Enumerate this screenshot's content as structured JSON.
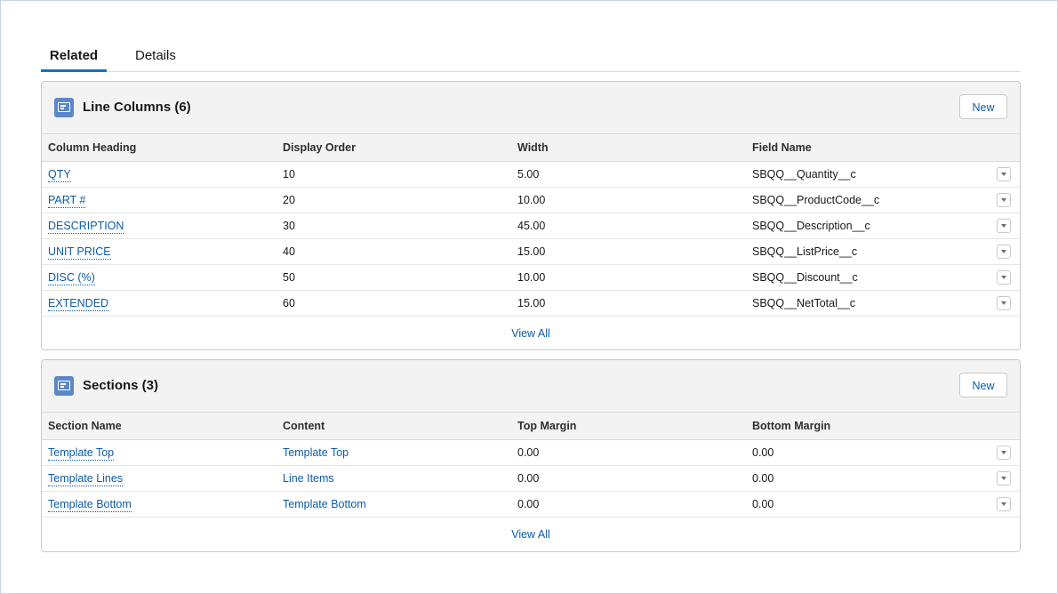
{
  "tabs": {
    "related": "Related",
    "details": "Details"
  },
  "line_columns": {
    "title": "Line Columns (6)",
    "new_label": "New",
    "headers": [
      "Column Heading",
      "Display Order",
      "Width",
      "Field Name"
    ],
    "rows": [
      {
        "heading": "QTY",
        "order": "10",
        "width": "5.00",
        "field": "SBQQ__Quantity__c"
      },
      {
        "heading": "PART #",
        "order": "20",
        "width": "10.00",
        "field": "SBQQ__ProductCode__c"
      },
      {
        "heading": "DESCRIPTION",
        "order": "30",
        "width": "45.00",
        "field": "SBQQ__Description__c"
      },
      {
        "heading": "UNIT PRICE",
        "order": "40",
        "width": "15.00",
        "field": "SBQQ__ListPrice__c"
      },
      {
        "heading": "DISC (%)",
        "order": "50",
        "width": "10.00",
        "field": "SBQQ__Discount__c"
      },
      {
        "heading": "EXTENDED",
        "order": "60",
        "width": "15.00",
        "field": "SBQQ__NetTotal__c"
      }
    ],
    "view_all": "View All"
  },
  "sections": {
    "title": "Sections (3)",
    "new_label": "New",
    "headers": [
      "Section Name",
      "Content",
      "Top Margin",
      "Bottom Margin"
    ],
    "rows": [
      {
        "name": "Template Top",
        "content": "Template Top",
        "top": "0.00",
        "bottom": "0.00"
      },
      {
        "name": "Template Lines",
        "content": "Line Items",
        "top": "0.00",
        "bottom": "0.00"
      },
      {
        "name": "Template Bottom",
        "content": "Template Bottom",
        "top": "0.00",
        "bottom": "0.00"
      }
    ],
    "view_all": "View All"
  },
  "icons": {
    "card_icon": "document-icon",
    "row_menu": "chevron-down-icon"
  },
  "colors": {
    "accent": "#0176d3",
    "link": "#0b5cab",
    "icon_bg": "#5b87c6"
  }
}
